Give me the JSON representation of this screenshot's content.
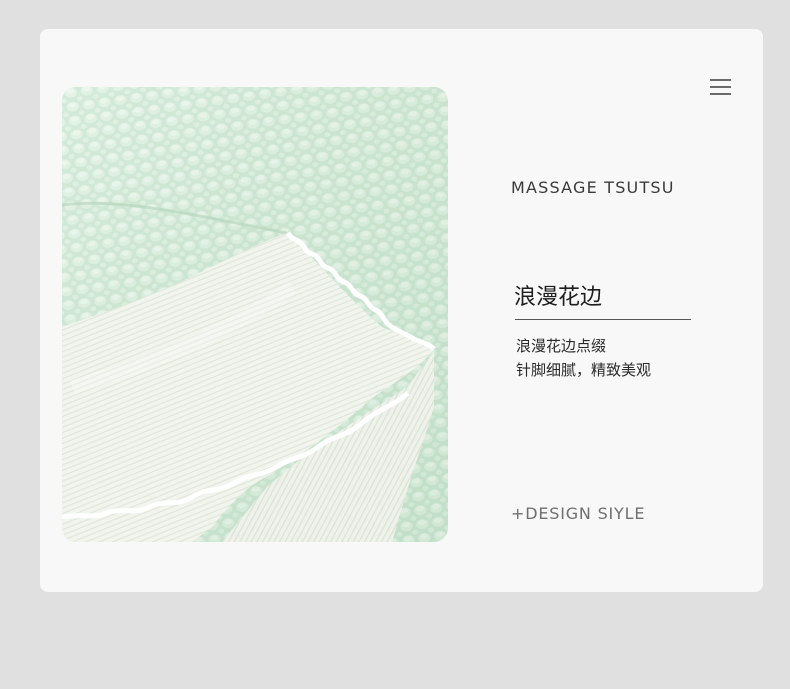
{
  "header": {
    "menu_icon": "hamburger-menu-icon"
  },
  "product": {
    "brand": "MASSAGE TSUTSU",
    "photo_subject": "mint green quilted fabric with white ruffled lace edge",
    "colors": {
      "fabric_mint": "#cfe8d4",
      "fabric_ruffle": "#f3f5ef",
      "card_bg": "#f8f8f8",
      "page_bg": "#e0e0e0"
    }
  },
  "feature": {
    "title": "浪漫花边",
    "desc_line1": "浪漫花边点缀",
    "desc_line2": "针脚细腻，精致美观"
  },
  "footer": {
    "design_label": "+DESIGN SIYLE"
  }
}
